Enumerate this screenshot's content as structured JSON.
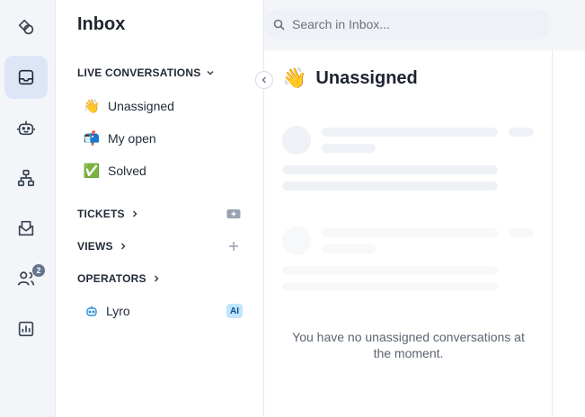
{
  "sidebar": {
    "title": "Inbox",
    "live_section": {
      "label": "LIVE CONVERSATIONS",
      "chevron": "chevron-down-icon"
    },
    "live_items": [
      {
        "label": "Unassigned",
        "emoji": "👋"
      },
      {
        "label": "My open",
        "emoji": "📬"
      },
      {
        "label": "Solved",
        "emoji": "✅"
      }
    ],
    "tickets": {
      "label": "TICKETS"
    },
    "views": {
      "label": "VIEWS"
    },
    "operators": {
      "label": "OPERATORS"
    },
    "lyro": {
      "label": "Lyro",
      "tag": "AI"
    }
  },
  "rail": {
    "badge_count": "2",
    "icons": [
      "shapes-icon",
      "inbox-icon",
      "bot-icon",
      "flow-icon",
      "mail-icon",
      "users-icon",
      "analytics-icon"
    ]
  },
  "search": {
    "placeholder": "Search in Inbox..."
  },
  "panel": {
    "title": "Unassigned",
    "emoji": "👋",
    "empty_message": "You have no unassigned conversations at the moment."
  },
  "colors": {
    "accent": "#dde6f7",
    "ai_tag": "#bfe5ff",
    "rail_bg": "#f3f5f9"
  }
}
